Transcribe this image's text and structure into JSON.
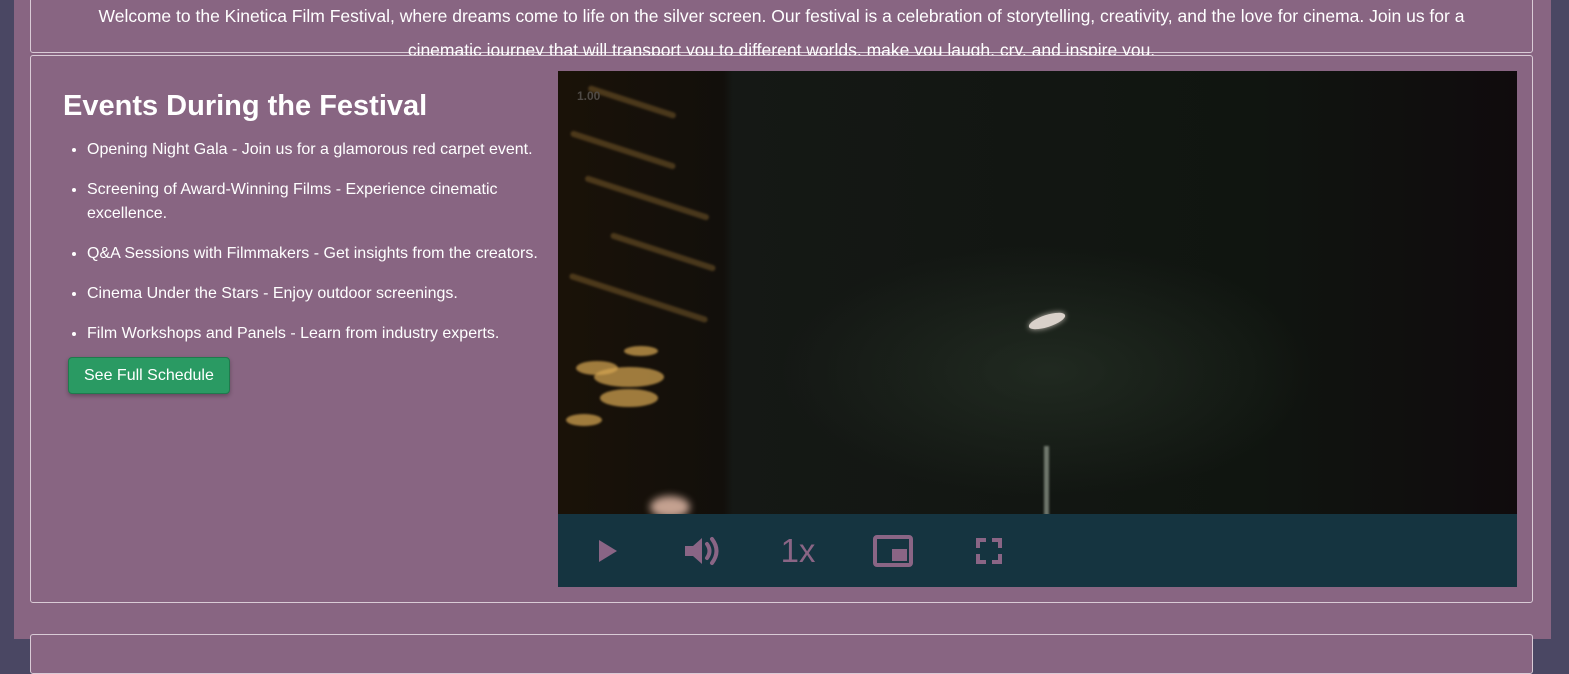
{
  "intro": {
    "text_line_one": "Welcome to the Kinetica Film Festival, where dreams come to life on the silver screen. Our festival is a celebration of storytelling, creativity, and the love for cinema. Join us for a",
    "text_line_two": "cinematic journey that will transport you to different worlds, make you laugh, cry, and inspire you."
  },
  "events": {
    "title": "Events During the Festival",
    "items": [
      "Opening Night Gala - Join us for a glamorous red carpet event.",
      "Screening of Award-Winning Films - Experience cinematic excellence.",
      "Q&A Sessions with Filmmakers - Get insights from the creators.",
      "Cinema Under the Stars - Enjoy outdoor screenings.",
      "Film Workshops and Panels - Learn from industry experts."
    ],
    "schedule_button_label": "See Full Schedule"
  },
  "video": {
    "speed_overlay": "1.00",
    "speed_label": "1x",
    "icons": {
      "play": "play-icon",
      "volume": "volume-icon",
      "pip": "picture-in-picture-icon",
      "fullscreen": "fullscreen-icon"
    }
  },
  "colors": {
    "page_background": "#886582",
    "outer_background": "#4a4763",
    "panel_border": "#d9cbd6",
    "schedule_button": "#2a9a63",
    "video_controls_bar": "#153440",
    "video_control_icons": "#8a6585"
  }
}
